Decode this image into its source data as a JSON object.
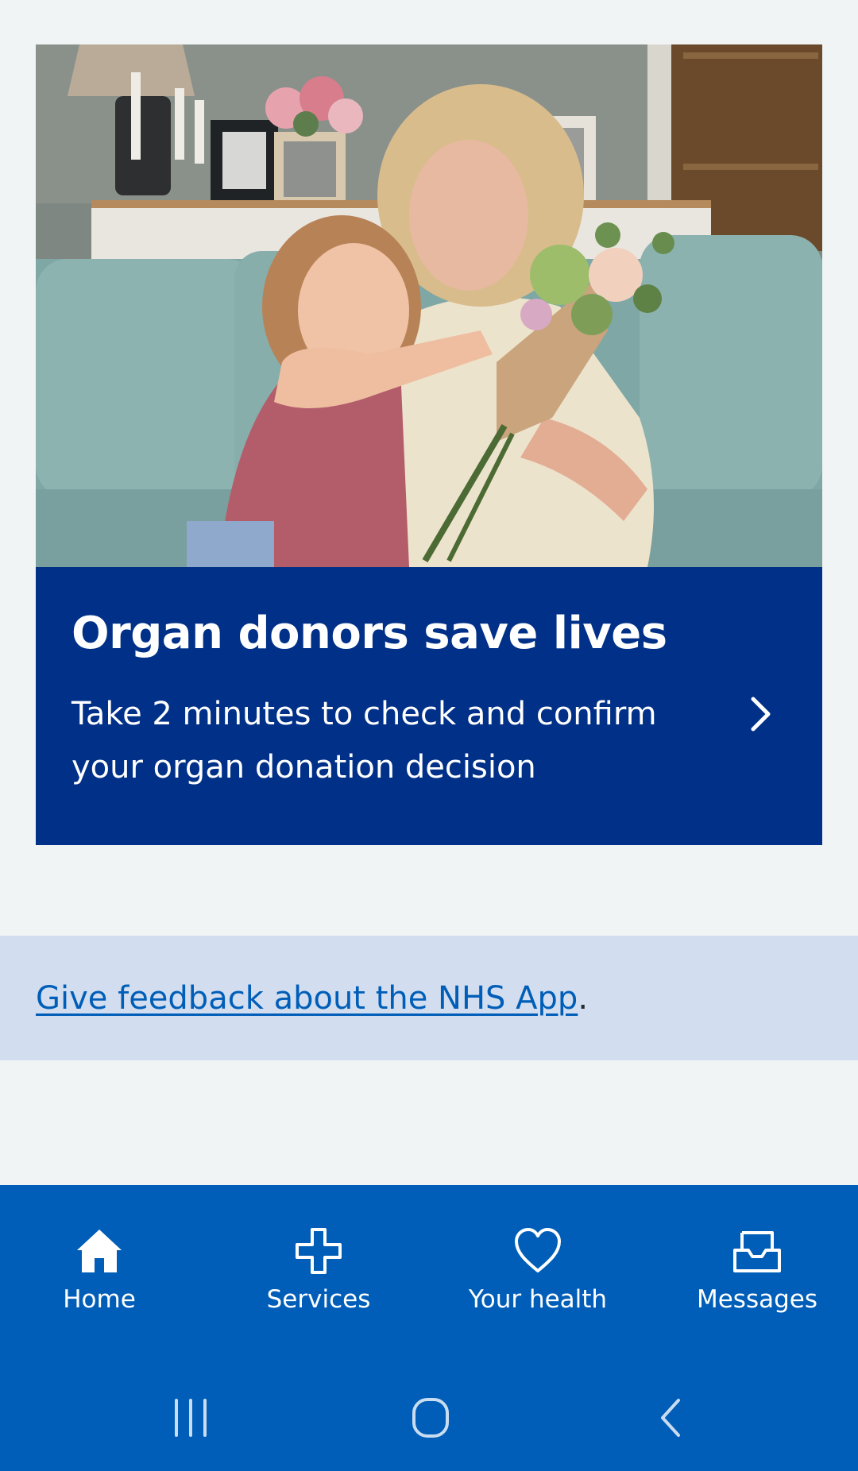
{
  "promo": {
    "image_alt": "Grandmother kissing a smiling girl on a sofa while holding a bouquet of flowers",
    "title": "Organ donors save lives",
    "description": "Take 2 minutes to check and confirm your organ donation decision",
    "chevron_icon": "chevron-right-icon"
  },
  "feedback": {
    "link_text": "Give feedback about the NHS App",
    "suffix": "."
  },
  "bottom_nav": {
    "items": [
      {
        "label": "Home",
        "icon": "home-icon"
      },
      {
        "label": "Services",
        "icon": "plus-icon"
      },
      {
        "label": "Your health",
        "icon": "heart-icon"
      },
      {
        "label": "Messages",
        "icon": "inbox-icon"
      }
    ]
  },
  "system_bar": {
    "recents_icon": "recent-apps-icon",
    "home_icon": "home-button-icon",
    "back_icon": "back-icon"
  },
  "colors": {
    "background": "#f0f4f5",
    "promo_panel": "#003087",
    "feedback_banner": "#d2deef",
    "link": "#005eb8",
    "nav_bar": "#005eb8",
    "white": "#ffffff"
  }
}
